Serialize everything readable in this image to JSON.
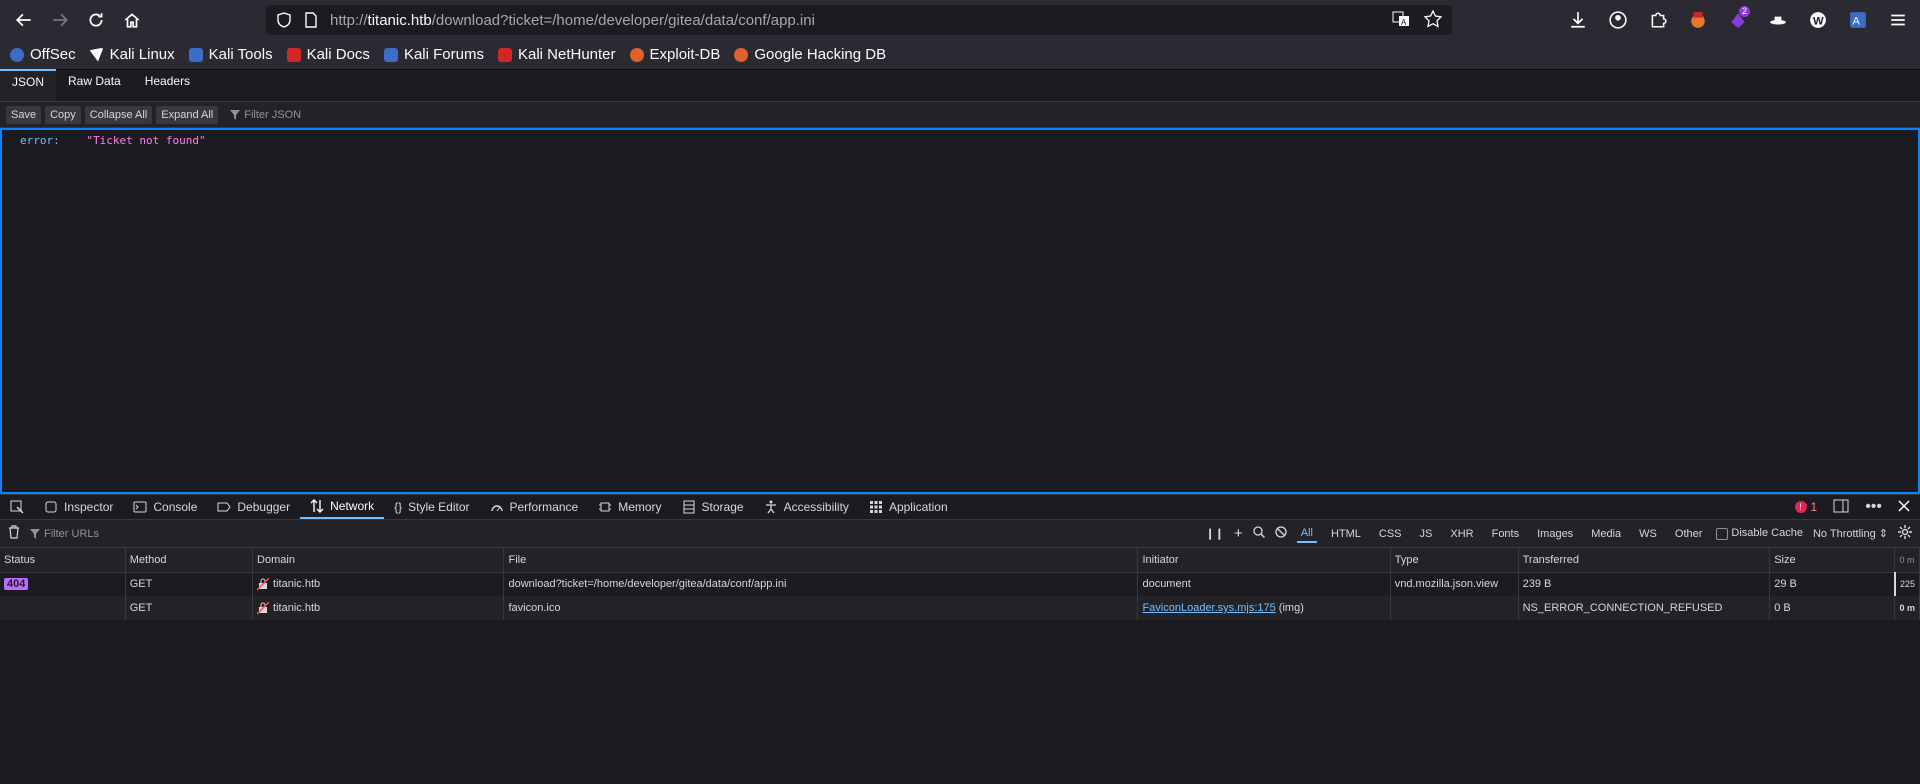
{
  "browser": {
    "url_prefix": "http://",
    "url_host": "titanic.htb",
    "url_path": "/download?ticket=/home/developer/gitea/data/conf/app.ini",
    "extension_badge": "2"
  },
  "bookmarks": [
    {
      "label": "OffSec",
      "color": "#3b6cc6"
    },
    {
      "label": "Kali Linux",
      "color": "#2b2a33"
    },
    {
      "label": "Kali Tools",
      "color": "#3b6cc6"
    },
    {
      "label": "Kali Docs",
      "color": "#d32626"
    },
    {
      "label": "Kali Forums",
      "color": "#3b6cc6"
    },
    {
      "label": "Kali NetHunter",
      "color": "#d32626"
    },
    {
      "label": "Exploit-DB",
      "color": "#e0622a"
    },
    {
      "label": "Google Hacking DB",
      "color": "#e0622a"
    }
  ],
  "json_viewer": {
    "tabs": [
      "JSON",
      "Raw Data",
      "Headers"
    ],
    "buttons": [
      "Save",
      "Copy",
      "Collapse All",
      "Expand All"
    ],
    "filter_placeholder": "Filter JSON",
    "key": "error:",
    "value": "\"Ticket not found\""
  },
  "devtools": {
    "tabs": [
      "Inspector",
      "Console",
      "Debugger",
      "Network",
      "Style Editor",
      "Performance",
      "Memory",
      "Storage",
      "Accessibility",
      "Application"
    ],
    "error_count": "1",
    "filter_placeholder": "Filter URLs",
    "type_filters": [
      "All",
      "HTML",
      "CSS",
      "JS",
      "XHR",
      "Fonts",
      "Images",
      "Media",
      "WS",
      "Other"
    ],
    "disable_cache": "Disable Cache",
    "throttling": "No Throttling ⇕",
    "columns": [
      "Status",
      "Method",
      "Domain",
      "File",
      "Initiator",
      "Type",
      "Transferred",
      "Size",
      ""
    ],
    "rows": [
      {
        "status": "404",
        "method": "GET",
        "domain": "titanic.htb",
        "file": "download?ticket=/home/developer/gitea/data/conf/app.ini",
        "initiator": "document",
        "initiator_extra": "",
        "type": "vnd.mozilla.json.view",
        "transferred": "239 B",
        "size": "29 B",
        "timing": "225"
      },
      {
        "status": "",
        "method": "GET",
        "domain": "titanic.htb",
        "file": "favicon.ico",
        "initiator": "FaviconLoader.sys.mjs:175",
        "initiator_extra": " (img)",
        "type": "",
        "transferred": "NS_ERROR_CONNECTION_REFUSED",
        "size": "0 B",
        "timing": "0 m"
      }
    ],
    "timing_header": "0 m"
  }
}
